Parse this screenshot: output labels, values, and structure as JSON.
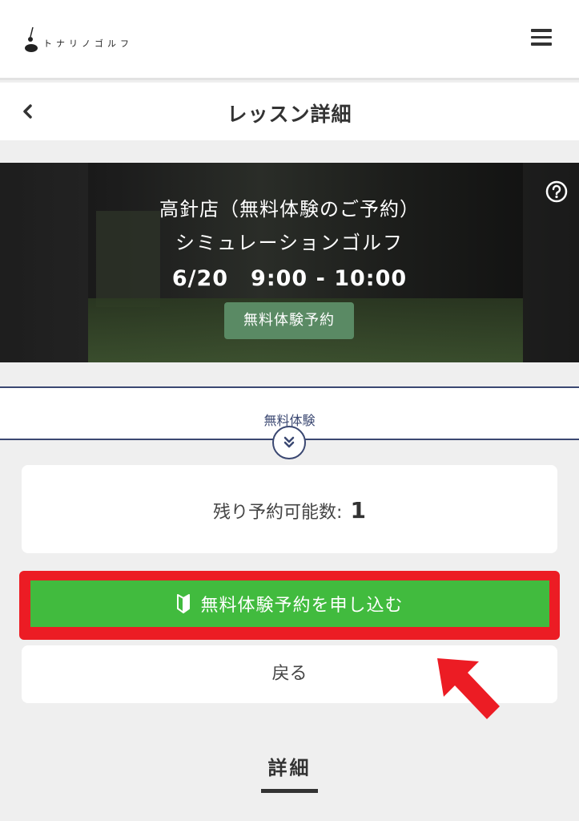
{
  "header": {
    "logo_text": "トナリノゴルフ"
  },
  "titlebar": {
    "title": "レッスン詳細"
  },
  "hero": {
    "store": "高針店（無料体験のご予約）",
    "lesson_type": "シミュレーションゴルフ",
    "schedule": "6/20　9:00 - 10:00",
    "badge": "無料体験予約"
  },
  "plan": {
    "label": "無料体験"
  },
  "availability": {
    "label": "残り予約可能数:",
    "count": "1"
  },
  "actions": {
    "apply_label": "無料体験予約を申し込む",
    "back_label": "戻る"
  },
  "details": {
    "heading": "詳細"
  },
  "colors": {
    "navy": "#3b4872",
    "apply_green": "#41bb3e",
    "highlight_red": "#ec1c24",
    "badge_green": "#5a8a64"
  }
}
